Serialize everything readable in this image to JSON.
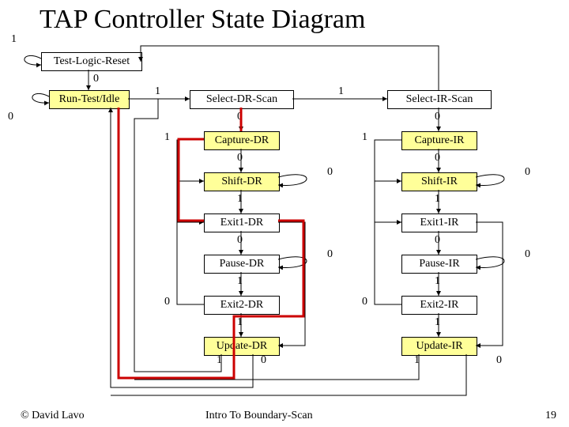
{
  "title": "TAP Controller State Diagram",
  "states": {
    "tlr": "Test-Logic-Reset",
    "rti": "Run-Test/Idle",
    "sds": "Select-DR-Scan",
    "sis": "Select-IR-Scan",
    "cdr": "Capture-DR",
    "sdr": "Shift-DR",
    "e1d": "Exit1-DR",
    "pdr": "Pause-DR",
    "e2d": "Exit2-DR",
    "udr": "Update-DR",
    "cir": "Capture-IR",
    "sir": "Shift-IR",
    "e1i": "Exit1-IR",
    "pir": "Pause-IR",
    "e2i": "Exit2-IR",
    "uir": "Update-IR"
  },
  "labels": {
    "one": "1",
    "zero": "0"
  },
  "footer": {
    "copyright": "© David Lavo",
    "course": "Intro To Boundary-Scan",
    "page": "19"
  }
}
